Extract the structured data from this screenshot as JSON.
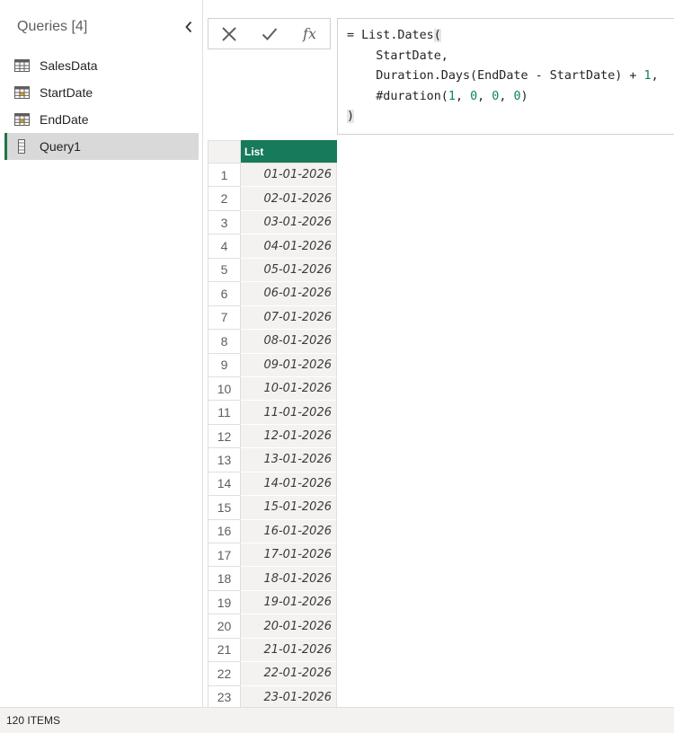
{
  "queries_pane": {
    "title": "Queries [4]",
    "collapse_icon": "chevron-left-icon",
    "items": [
      {
        "label": "SalesData",
        "icon": "table-icon"
      },
      {
        "label": "StartDate",
        "icon": "parameter-table-icon"
      },
      {
        "label": "EndDate",
        "icon": "parameter-table-icon"
      },
      {
        "label": "Query1",
        "icon": "list-icon",
        "selected": true
      }
    ]
  },
  "formula_bar": {
    "cancel_icon": "close-icon",
    "commit_icon": "checkmark-icon",
    "fx_label": "fx",
    "lines": [
      "= List.Dates(",
      "    StartDate,",
      "    Duration.Days(EndDate - StartDate) + 1,",
      "    #duration(1, 0, 0, 0)",
      ")"
    ]
  },
  "grid": {
    "column_header": "List",
    "rows": [
      {
        "n": "1",
        "v": "01-01-2026"
      },
      {
        "n": "2",
        "v": "02-01-2026"
      },
      {
        "n": "3",
        "v": "03-01-2026"
      },
      {
        "n": "4",
        "v": "04-01-2026"
      },
      {
        "n": "5",
        "v": "05-01-2026"
      },
      {
        "n": "6",
        "v": "06-01-2026"
      },
      {
        "n": "7",
        "v": "07-01-2026"
      },
      {
        "n": "8",
        "v": "08-01-2026"
      },
      {
        "n": "9",
        "v": "09-01-2026"
      },
      {
        "n": "10",
        "v": "10-01-2026"
      },
      {
        "n": "11",
        "v": "11-01-2026"
      },
      {
        "n": "12",
        "v": "12-01-2026"
      },
      {
        "n": "13",
        "v": "13-01-2026"
      },
      {
        "n": "14",
        "v": "14-01-2026"
      },
      {
        "n": "15",
        "v": "15-01-2026"
      },
      {
        "n": "16",
        "v": "16-01-2026"
      },
      {
        "n": "17",
        "v": "17-01-2026"
      },
      {
        "n": "18",
        "v": "18-01-2026"
      },
      {
        "n": "19",
        "v": "19-01-2026"
      },
      {
        "n": "20",
        "v": "20-01-2026"
      },
      {
        "n": "21",
        "v": "21-01-2026"
      },
      {
        "n": "22",
        "v": "22-01-2026"
      },
      {
        "n": "23",
        "v": "23-01-2026"
      }
    ]
  },
  "status_bar": {
    "items_label": "120 ITEMS"
  },
  "colors": {
    "column_header_bg": "#167a5b",
    "selection_accent": "#217346",
    "number_literal": "#098658"
  }
}
